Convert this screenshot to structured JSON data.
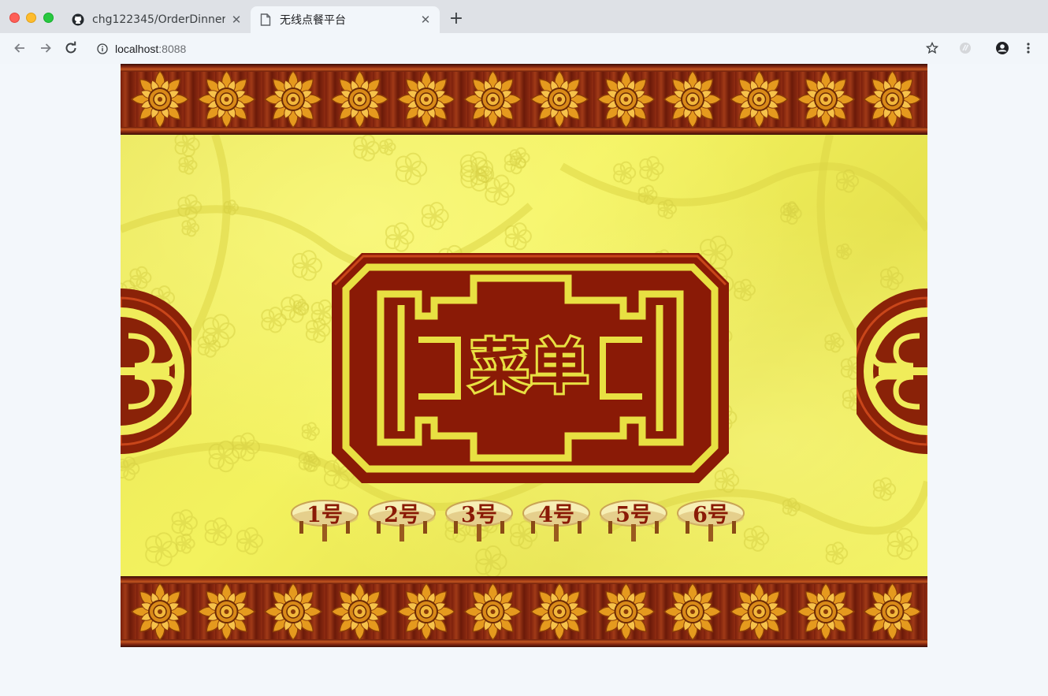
{
  "browser": {
    "tabs": [
      {
        "title": "chg122345/OrderDinner:",
        "favicon": "github-icon"
      },
      {
        "title": "无线点餐平台",
        "favicon": "page-icon"
      }
    ],
    "address": {
      "host": "localhost",
      "port": ":8088"
    }
  },
  "page": {
    "menu_title": "菜单",
    "tables": [
      {
        "label": "1号"
      },
      {
        "label": "2号"
      },
      {
        "label": "3号"
      },
      {
        "label": "4号"
      },
      {
        "label": "5号"
      },
      {
        "label": "6号"
      }
    ],
    "colors": {
      "plaque_red": "#8a1a06",
      "plaque_gold": "#e8e042",
      "field_yellow": "#eeed58",
      "wood_dark": "#6b1d0b"
    }
  }
}
